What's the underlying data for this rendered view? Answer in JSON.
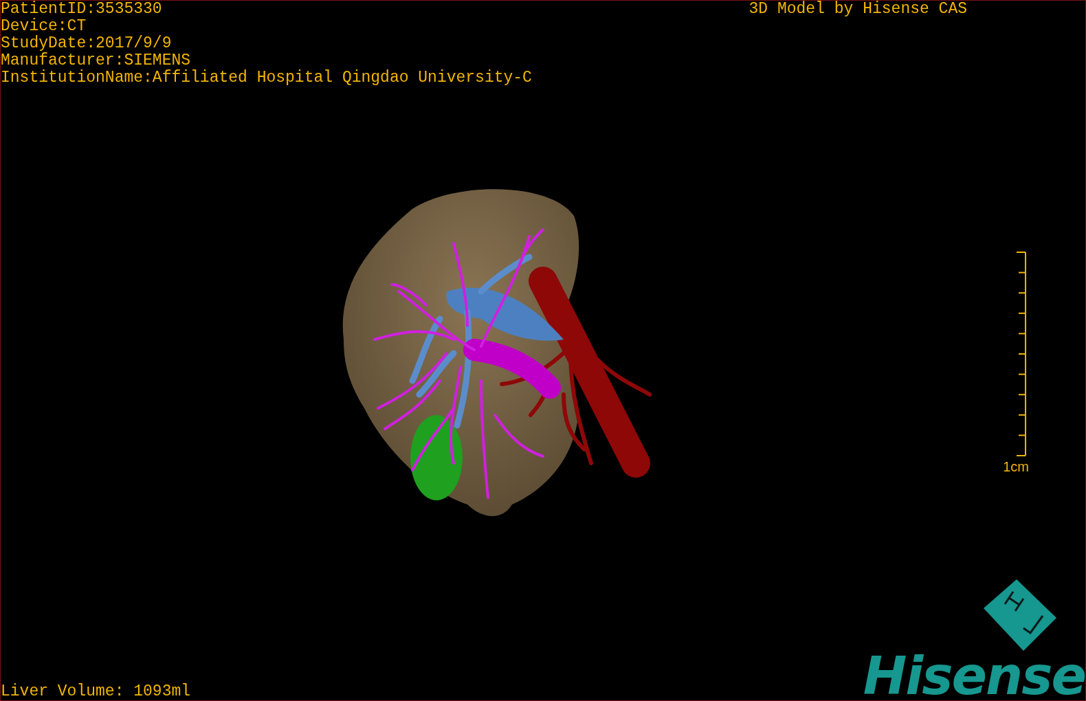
{
  "info_lines": [
    "PatientID:3535330",
    "Device:CT",
    "StudyDate:2017/9/9",
    "Manufacturer:SIEMENS",
    "InstitutionName:Affiliated Hospital Qingdao University-C"
  ],
  "header_title": "3D Model by Hisense CAS",
  "scale_bar": {
    "label": "1cm"
  },
  "liver_volume": "Liver Volume: 1093ml",
  "logo": {
    "text": "Hisense"
  }
}
